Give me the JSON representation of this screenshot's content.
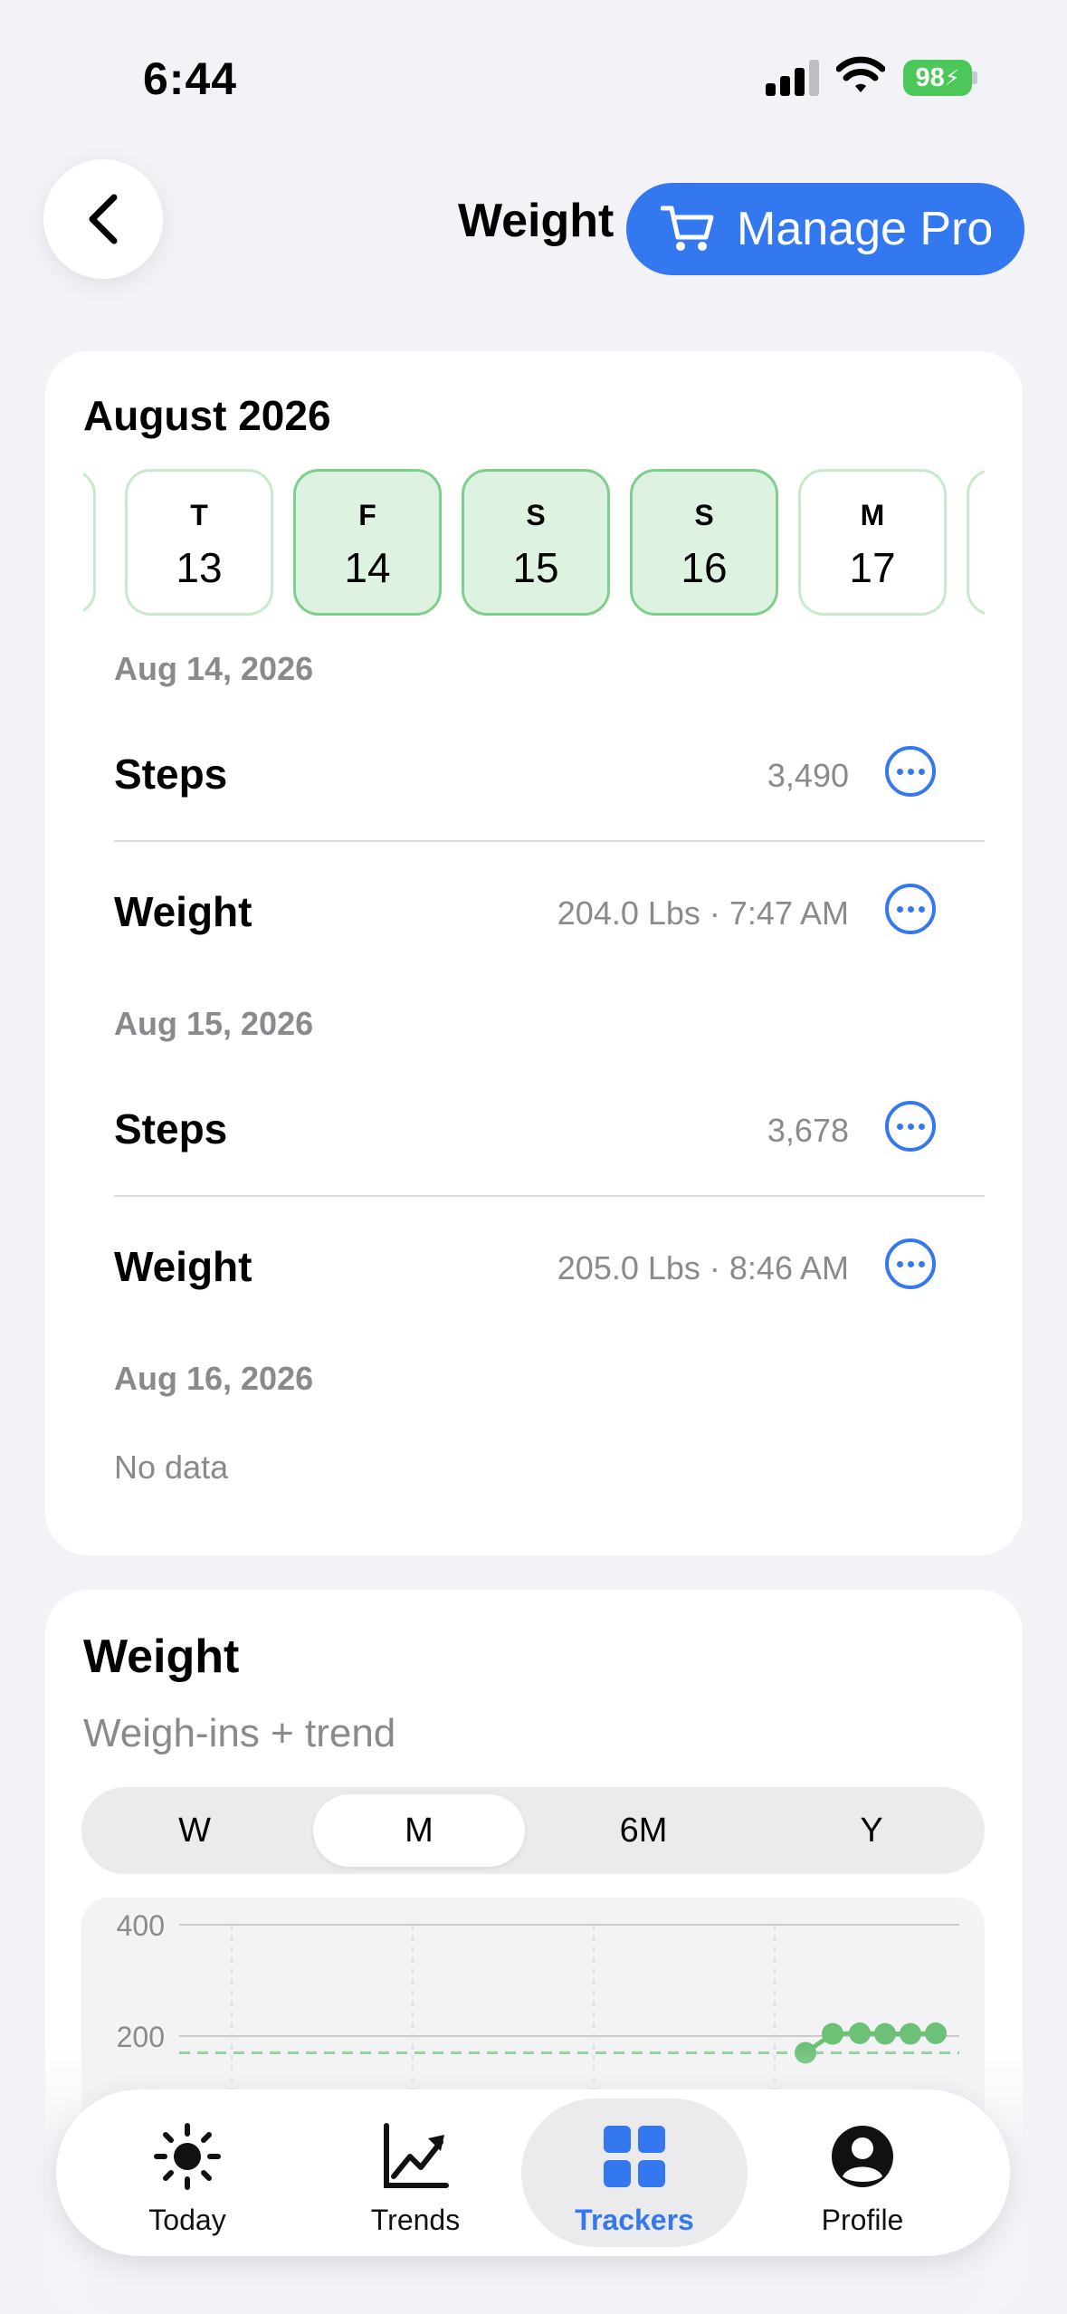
{
  "status_bar": {
    "time": "6:44",
    "battery": "98"
  },
  "header": {
    "title": "Weight",
    "manage_pro": "Manage Pro"
  },
  "calendar": {
    "month": "August 2026",
    "days": [
      {
        "letter": "T",
        "num": "13",
        "selected": false
      },
      {
        "letter": "F",
        "num": "14",
        "selected": true
      },
      {
        "letter": "S",
        "num": "15",
        "selected": true
      },
      {
        "letter": "S",
        "num": "16",
        "selected": true
      },
      {
        "letter": "M",
        "num": "17",
        "selected": false
      }
    ]
  },
  "log": [
    {
      "date": "Aug 14, 2026",
      "rows": [
        {
          "label": "Steps",
          "value": "3,490"
        },
        {
          "label": "Weight",
          "value": "204.0 Lbs · 7:47 AM"
        }
      ]
    },
    {
      "date": "Aug 15, 2026",
      "rows": [
        {
          "label": "Steps",
          "value": "3,678"
        },
        {
          "label": "Weight",
          "value": "205.0 Lbs · 8:46 AM"
        }
      ]
    },
    {
      "date": "Aug 16, 2026",
      "no_data": "No data"
    }
  ],
  "weight_card": {
    "title": "Weight",
    "subtitle": "Weigh-ins + trend",
    "ranges": [
      "W",
      "M",
      "6M",
      "Y"
    ],
    "active_range": "M"
  },
  "chart_data": {
    "type": "line",
    "y_ticks": [
      "400",
      "200"
    ],
    "ylim": [
      0,
      400
    ],
    "trend_value": 170,
    "series": [
      {
        "values": [
          170,
          204,
          205,
          204,
          204,
          205
        ]
      }
    ],
    "colors": {
      "line": "#6cc177",
      "trend": "#8fd19b",
      "grid": "#c9c9ce"
    }
  },
  "tab_bar": {
    "tabs": [
      {
        "label": "Today",
        "icon": "sun-icon"
      },
      {
        "label": "Trends",
        "icon": "trend-chart-icon"
      },
      {
        "label": "Trackers",
        "icon": "grid-icon"
      },
      {
        "label": "Profile",
        "icon": "person-circle-icon"
      }
    ],
    "active": "Trackers"
  }
}
